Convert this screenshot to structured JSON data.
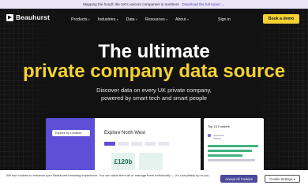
{
  "announcement": {
    "text": "Mapping the hoodl: the UK's unicorn companies in numbers",
    "link": "Download the full report →"
  },
  "brand": {
    "name": "Beauhurst"
  },
  "nav": {
    "items": [
      {
        "label": "Products",
        "has_dropdown": true
      },
      {
        "label": "Industries",
        "has_dropdown": true
      },
      {
        "label": "Data",
        "has_dropdown": true
      },
      {
        "label": "Resources",
        "has_dropdown": true
      },
      {
        "label": "About",
        "has_dropdown": true
      }
    ],
    "chevron": "▾",
    "signin": "Sign in",
    "demo": "Book a demo"
  },
  "hero": {
    "line1": "The ultimate",
    "line2": "private company data source",
    "sub1": "Discover data on every UK private company,",
    "sub2": "powered by smart tech and smart people"
  },
  "preview": {
    "pill": "Explore by Location",
    "title": "Explore North West",
    "value": "£120b",
    "side_title": "Top 10 Funders"
  },
  "cookie": {
    "text": "We use cookies to enhance your Beauhurst browsing experience. You can allow them all or manage them individually — it's completely up to you.",
    "accept": "Accept All Cookies",
    "settings": "Cookie Settings",
    "settings_chevron": "▾"
  },
  "colors": {
    "accent": "#f5d231",
    "purple": "#5d4fd6",
    "background": "#121212"
  }
}
